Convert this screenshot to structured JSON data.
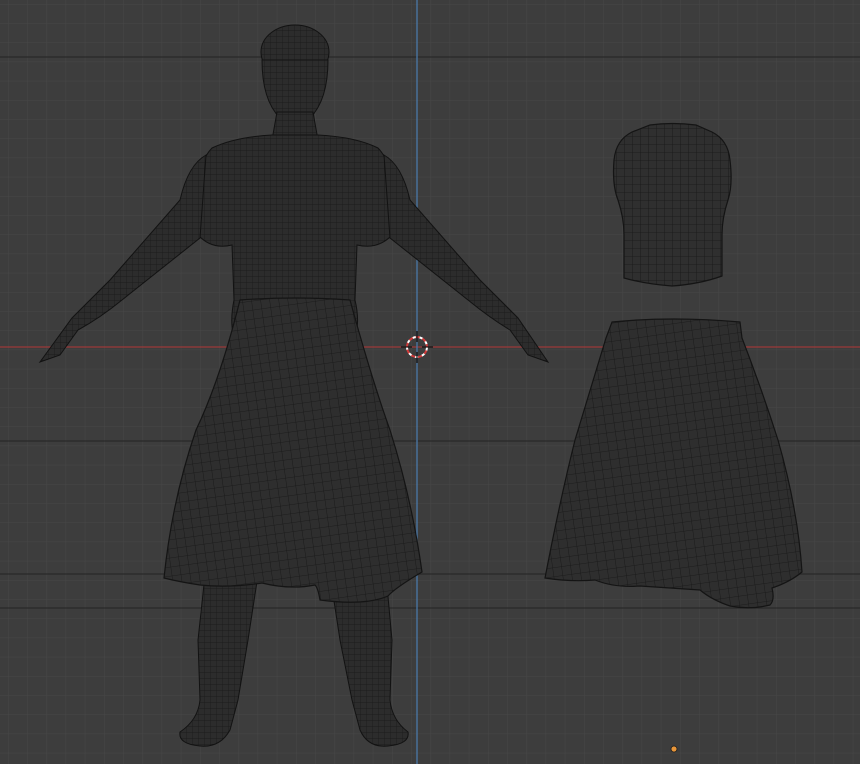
{
  "viewport": {
    "view": "front-orthographic",
    "display_mode": "wireframe",
    "colors": {
      "background": "#3d3d3d",
      "grid_minor": "#464646",
      "grid_major": "#2c2c2c",
      "x_axis": "#9b3a3a",
      "z_axis": "#4a78a8",
      "mesh_fill": "#2b2b2b",
      "mesh_wire": "#181818",
      "origin_point": "#e8963a"
    }
  },
  "objects": [
    {
      "name": "body-mesh",
      "kind": "female-base-mesh"
    },
    {
      "name": "skirt-on-body",
      "kind": "cloth-skirt"
    },
    {
      "name": "crop-top",
      "kind": "cloth-top"
    },
    {
      "name": "skirt",
      "kind": "cloth-skirt"
    }
  ],
  "widgets": {
    "cursor_icon": "3d-cursor-icon",
    "origin_icon": "object-origin-icon"
  }
}
